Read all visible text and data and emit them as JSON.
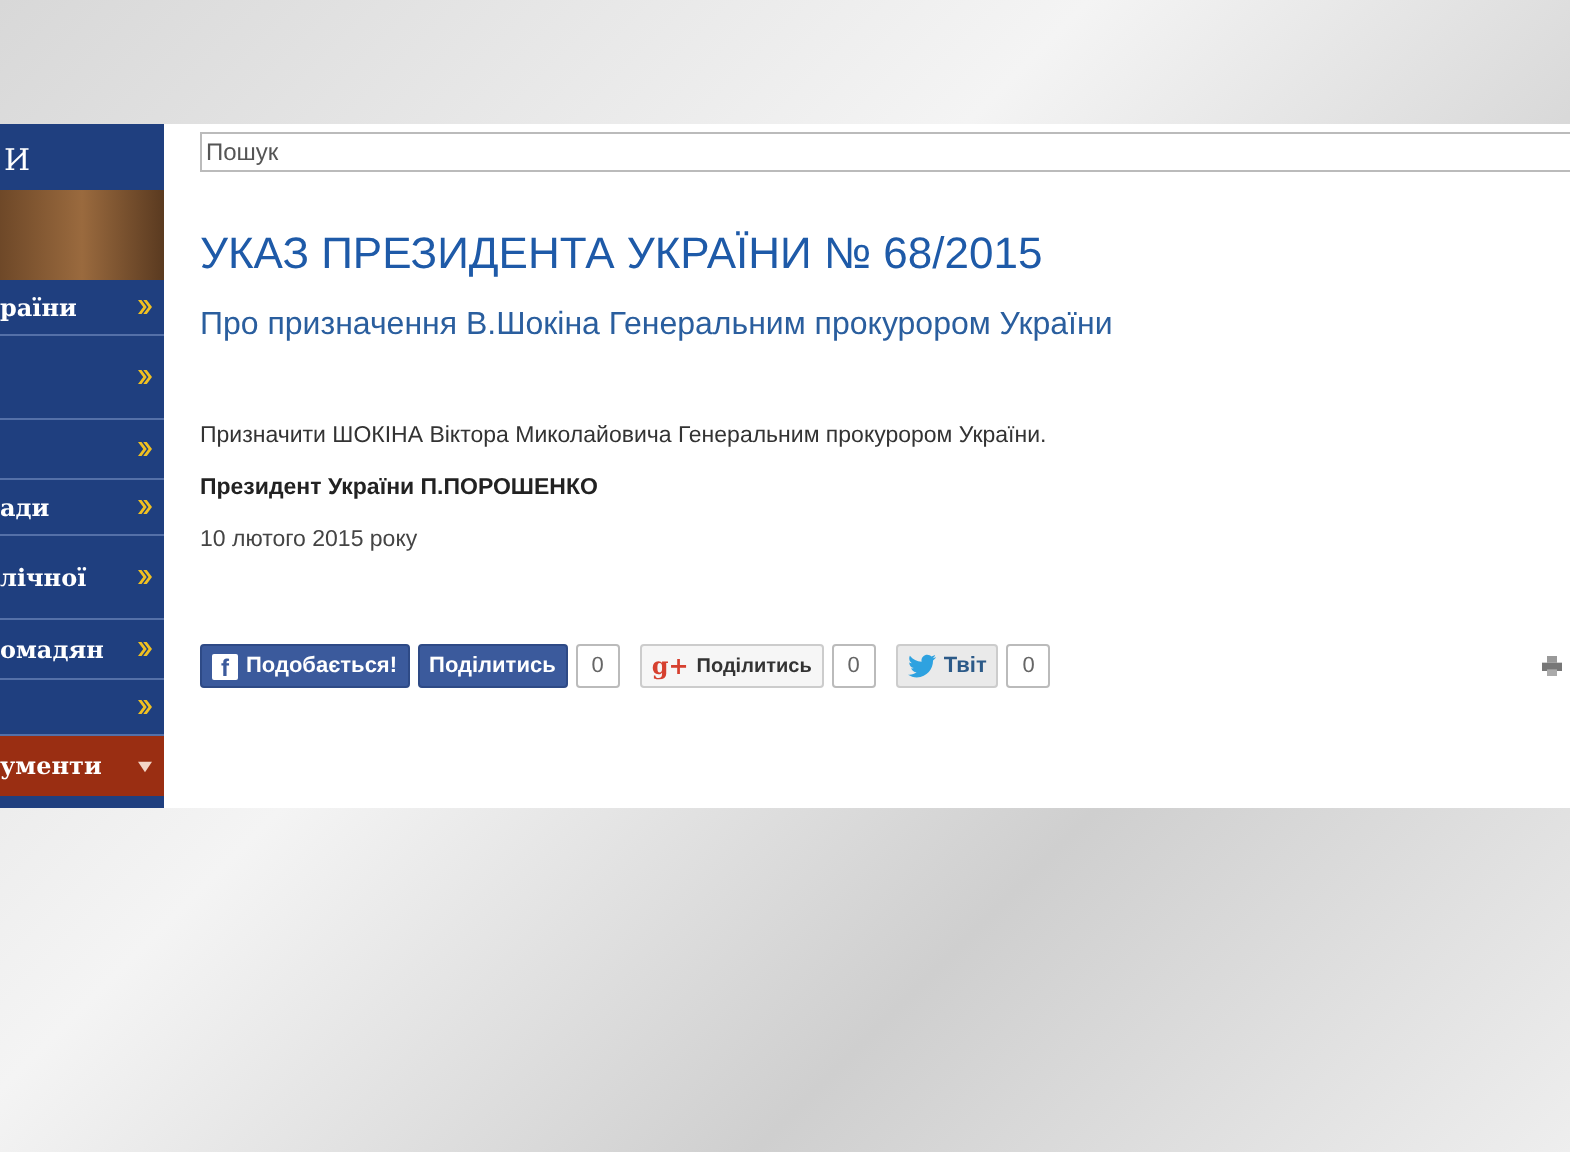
{
  "sidebar": {
    "title": "И",
    "items": [
      {
        "label": "раїни",
        "expanded": false
      },
      {
        "expanded": false
      },
      {
        "expanded": false
      },
      {
        "label": "ади",
        "expanded": false
      },
      {
        "label": "лічної",
        "expanded": false
      },
      {
        "label": "омадян",
        "expanded": false
      },
      {
        "expanded": false
      },
      {
        "label": "ументи",
        "expanded": true
      }
    ]
  },
  "search": {
    "placeholder": "Пошук"
  },
  "article": {
    "title": "УКАЗ ПРЕЗИДЕНТА УКРАЇНИ № 68/2015",
    "subtitle": "Про призначення В.Шокіна Генеральним прокурором України",
    "body": "Призначити ШОКІНА Віктора Миколайовича Генеральним прокурором України.",
    "signature": "Президент України П.ПОРОШЕНКО",
    "date": "10 лютого 2015 року"
  },
  "share": [
    {
      "kind": "facebook-like",
      "icon": "f",
      "label": "Подобається!"
    },
    {
      "kind": "facebook-share",
      "label": "Поділитись",
      "count": "0"
    },
    {
      "kind": "google",
      "icon": "g+",
      "label": "Поділитись",
      "count": "0"
    },
    {
      "kind": "twitter",
      "label": "Твіт",
      "count": "0"
    }
  ]
}
